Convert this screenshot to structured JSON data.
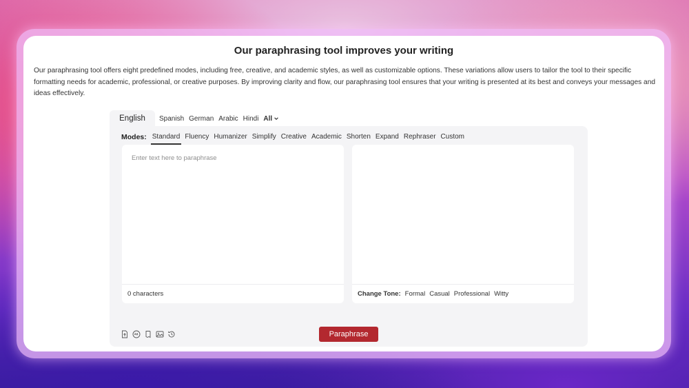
{
  "card": {
    "title": "Our paraphrasing tool improves your writing",
    "description": "Our paraphrasing tool offers eight predefined modes, including free, creative, and academic styles, as well as customizable options. These variations allow users to tailor the tool to their specific formatting needs for academic, professional, or creative purposes. By improving clarity and flow, our paraphrasing tool ensures that your writing is presented at its best and conveys your messages and ideas effectively."
  },
  "languages": {
    "active": "English",
    "items": [
      "Spanish",
      "German",
      "Arabic",
      "Hindi"
    ],
    "all_label": "All"
  },
  "modes": {
    "label": "Modes:",
    "items": [
      "Standard",
      "Fluency",
      "Humanizer",
      "Simplify",
      "Creative",
      "Academic",
      "Shorten",
      "Expand",
      "Rephraser",
      "Custom"
    ],
    "active_index": 0
  },
  "input": {
    "placeholder": "Enter text here to paraphrase",
    "char_count": "0 characters"
  },
  "output": {
    "tone_label": "Change Tone:",
    "tones": [
      "Formal",
      "Casual",
      "Professional",
      "Witty"
    ]
  },
  "toolbar_icons": [
    "upload-file-icon",
    "spell-check-icon",
    "document-icon",
    "image-icon",
    "history-icon"
  ],
  "paraphrase_button": "Paraphrase",
  "colors": {
    "button": "#b3282f",
    "panel": "#f4f4f6"
  }
}
